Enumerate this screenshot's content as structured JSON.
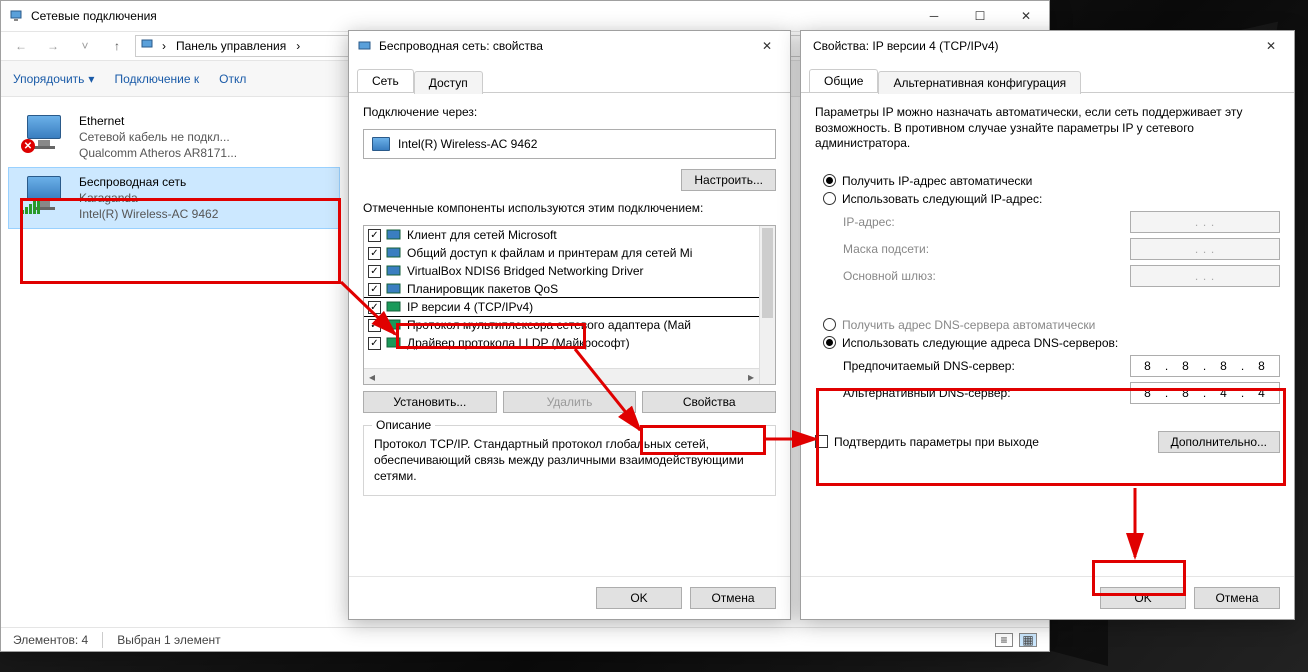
{
  "explorer": {
    "title": "Сетевые подключения",
    "breadcrumb_cp": "Панель управления",
    "cmdbar": {
      "organize": "Упорядочить",
      "connect": "Подключение к",
      "disable": "Откл"
    },
    "ethernet": {
      "name": "Ethernet",
      "status": "Сетевой кабель не подкл...",
      "adapter": "Qualcomm Atheros AR8171..."
    },
    "wifi": {
      "name": "Беспроводная сеть",
      "ssid": "Karaganda",
      "adapter": "Intel(R) Wireless-AC 9462"
    },
    "status_items": "Элементов: 4",
    "status_selected": "Выбран 1 элемент"
  },
  "dlg1": {
    "title": "Беспроводная сеть: свойства",
    "tab_net": "Сеть",
    "tab_access": "Доступ",
    "connect_via": "Подключение через:",
    "adapter": "Intel(R) Wireless-AC 9462",
    "btn_configure": "Настроить...",
    "components_label": "Отмеченные компоненты используются этим подключением:",
    "components": [
      "Клиент для сетей Microsoft",
      "Общий доступ к файлам и принтерам для сетей Mi",
      "VirtualBox NDIS6 Bridged Networking Driver",
      "Планировщик пакетов QoS",
      "IP версии 4 (TCP/IPv4)",
      "Протокол мультиплексора сетевого адаптера (Май",
      "Драйвер протокола LLDP (Майкрософт)"
    ],
    "btn_install": "Установить...",
    "btn_remove": "Удалить",
    "btn_props": "Свойства",
    "desc_title": "Описание",
    "desc_text": "Протокол TCP/IP. Стандартный протокол глобальных сетей, обеспечивающий связь между различными взаимодействующими сетями.",
    "ok": "OK",
    "cancel": "Отмена"
  },
  "dlg2": {
    "title": "Свойства: IP версии 4 (TCP/IPv4)",
    "tab_general": "Общие",
    "tab_alt": "Альтернативная конфигурация",
    "help_text": "Параметры IP можно назначать автоматически, если сеть поддерживает эту возможность. В противном случае узнайте параметры IP у сетевого администратора.",
    "r_auto_ip": "Получить IP-адрес автоматически",
    "r_manual_ip": "Использовать следующий IP-адрес:",
    "lbl_ip": "IP-адрес:",
    "lbl_mask": "Маска подсети:",
    "lbl_gw": "Основной шлюз:",
    "r_auto_dns": "Получить адрес DNS-сервера автоматически",
    "r_manual_dns": "Использовать следующие адреса DNS-серверов:",
    "lbl_dns1": "Предпочитаемый DNS-сервер:",
    "lbl_dns2": "Альтернативный DNS-сервер:",
    "dns1": [
      "8",
      "8",
      "8",
      "8"
    ],
    "dns2": [
      "8",
      "8",
      "4",
      "4"
    ],
    "chk_validate": "Подтвердить параметры при выходе",
    "btn_advanced": "Дополнительно...",
    "ok": "OK",
    "cancel": "Отмена"
  }
}
